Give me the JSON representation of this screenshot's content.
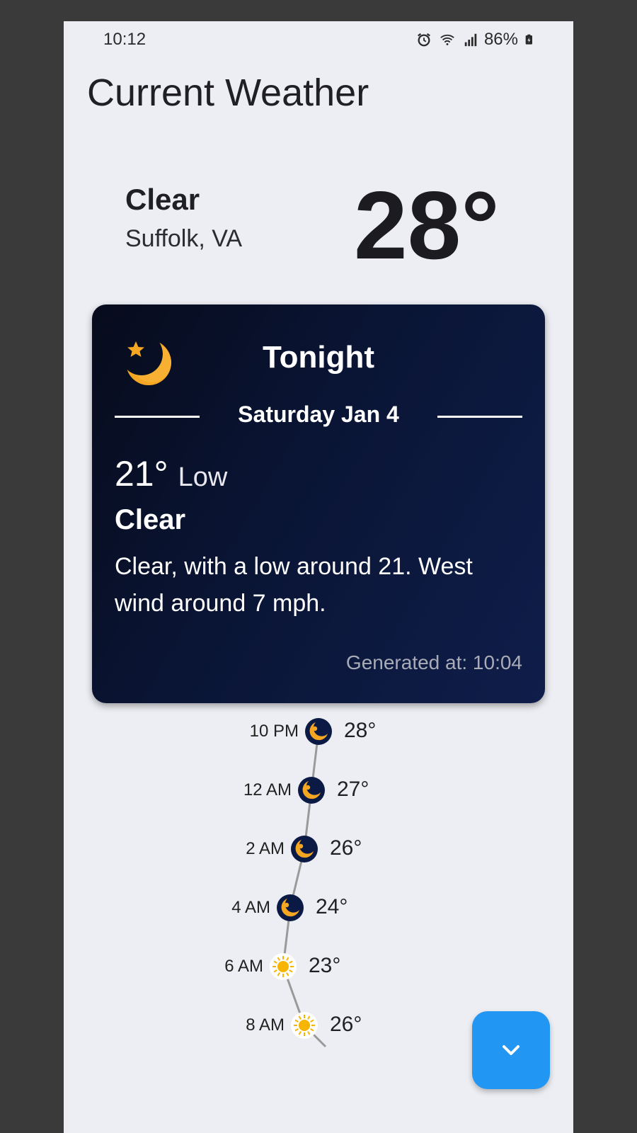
{
  "status": {
    "time": "10:12",
    "battery": "86%"
  },
  "app": {
    "title": "Current Weather"
  },
  "current": {
    "condition": "Clear",
    "location": "Suffolk, VA",
    "temperature": "28°"
  },
  "card": {
    "title": "Tonight",
    "date": "Saturday Jan 4",
    "low_temp": "21°",
    "low_label": "Low",
    "condition": "Clear",
    "description": "Clear, with a low around 21. West wind around 7 mph.",
    "generated": "Generated at: 10:04",
    "icon": "moon-star-icon"
  },
  "hourly": [
    {
      "time": "10 PM",
      "temp": "28°",
      "icon": "moon-icon",
      "value": 28
    },
    {
      "time": "12 AM",
      "temp": "27°",
      "icon": "moon-icon",
      "value": 27
    },
    {
      "time": "2 AM",
      "temp": "26°",
      "icon": "moon-icon",
      "value": 26
    },
    {
      "time": "4 AM",
      "temp": "24°",
      "icon": "moon-icon",
      "value": 24
    },
    {
      "time": "6 AM",
      "temp": "23°",
      "icon": "sun-icon",
      "value": 23
    },
    {
      "time": "8 AM",
      "temp": "26°",
      "icon": "sun-icon",
      "value": 26
    }
  ],
  "colors": {
    "background": "#edeef3",
    "card_start": "#070b1c",
    "card_end": "#0f1d4a",
    "fab": "#2196f3",
    "moon": "#f5a623",
    "sun": "#f7b500"
  }
}
